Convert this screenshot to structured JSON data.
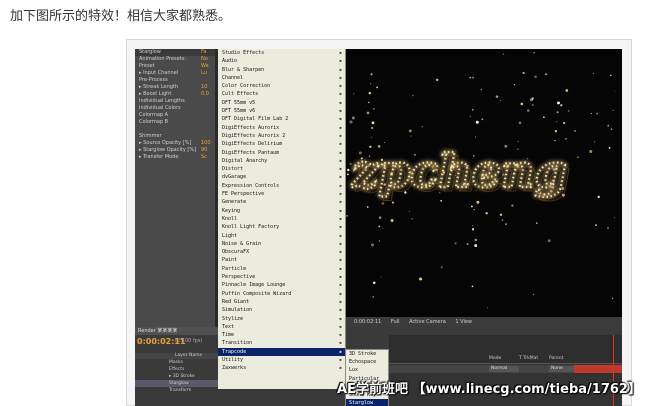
{
  "post": {
    "text": "加下图所示的特效！相信大家都熟悉。"
  },
  "effect_controls": {
    "rows": [
      {
        "label": "Starglow",
        "value": "Fa",
        "head": true
      },
      {
        "label": "Animation Presets:",
        "value": "No"
      },
      {
        "label": "Preset",
        "value": "Wa"
      },
      {
        "label": "▸ Input Channel",
        "value": "Lu"
      },
      {
        "label": "Pre-Process",
        "value": ""
      },
      {
        "label": "▸ Streak Length",
        "value": "10"
      },
      {
        "label": "▸ Boost Light",
        "value": "0.0"
      },
      {
        "label": "Individual Lengths",
        "value": ""
      },
      {
        "label": "Individual Colors",
        "value": ""
      },
      {
        "label": "Colormap A",
        "value": ""
      },
      {
        "label": "Colormap B",
        "value": ""
      },
      {
        "label": "",
        "value": ""
      },
      {
        "label": "Shimmer",
        "value": ""
      },
      {
        "label": "▸ Source Opacity [%]",
        "value": "100"
      },
      {
        "label": "▸ Starglow Opacity [%]",
        "value": "90"
      },
      {
        "label": "▸ Transfer Mode",
        "value": "Sc"
      }
    ]
  },
  "menu": {
    "items": [
      {
        "label": "Studio Effects",
        "has_sub": true
      },
      {
        "label": "Audio",
        "has_sub": true
      },
      {
        "label": "Blur & Sharpen",
        "has_sub": true
      },
      {
        "label": "Channel",
        "has_sub": true
      },
      {
        "label": "Color Correction",
        "has_sub": true
      },
      {
        "label": "Cult Effects",
        "has_sub": true
      },
      {
        "label": "DFT 55mm v5",
        "has_sub": true
      },
      {
        "label": "DFT 55mm v6",
        "has_sub": true
      },
      {
        "label": "DFT Digital Film Lab 2",
        "has_sub": true
      },
      {
        "label": "DigiEffects Aurorix",
        "has_sub": true
      },
      {
        "label": "DigiEffects Aurorix 2",
        "has_sub": true
      },
      {
        "label": "DigiEffects Delirium",
        "has_sub": true
      },
      {
        "label": "DigiEffects Pantaum",
        "has_sub": true
      },
      {
        "label": "Digital Anarchy",
        "has_sub": true
      },
      {
        "label": "Distort",
        "has_sub": true
      },
      {
        "label": "dvGarage",
        "has_sub": true
      },
      {
        "label": "Expression Controls",
        "has_sub": true
      },
      {
        "label": "FE Perspective",
        "has_sub": true
      },
      {
        "label": "Generate",
        "has_sub": true
      },
      {
        "label": "Keying",
        "has_sub": true
      },
      {
        "label": "Knoll",
        "has_sub": true
      },
      {
        "label": "Knoll Light Factory",
        "has_sub": true
      },
      {
        "label": "Light",
        "has_sub": true
      },
      {
        "label": "Noise & Grain",
        "has_sub": true
      },
      {
        "label": "ObscuraFX",
        "has_sub": true
      },
      {
        "label": "Paint",
        "has_sub": true
      },
      {
        "label": "Particle",
        "has_sub": true
      },
      {
        "label": "Perspective",
        "has_sub": true
      },
      {
        "label": "Pinnacle Image Lounge",
        "has_sub": true
      },
      {
        "label": "Puffin Composite Wizard",
        "has_sub": true
      },
      {
        "label": "Red Giant",
        "has_sub": true
      },
      {
        "label": "Simulation",
        "has_sub": true
      },
      {
        "label": "Stylize",
        "has_sub": true
      },
      {
        "label": "Text",
        "has_sub": true
      },
      {
        "label": "Time",
        "has_sub": true
      },
      {
        "label": "Transition",
        "has_sub": true
      },
      {
        "label": "Trapcode",
        "has_sub": true,
        "selected": true
      },
      {
        "label": "Utility",
        "has_sub": true
      },
      {
        "label": "Zaxwerks",
        "has_sub": true
      }
    ]
  },
  "submenu": {
    "items": [
      {
        "label": "3D Stroke"
      },
      {
        "label": "Echospace"
      },
      {
        "label": "Lux"
      },
      {
        "label": "Particular"
      },
      {
        "label": "Shine"
      },
      {
        "label": "Sound Keys"
      },
      {
        "label": "Starglow",
        "selected": true
      }
    ]
  },
  "viewer": {
    "art_text": "zpcheng",
    "zoom": "Full",
    "timecode": "0:00:02:11",
    "camera": "Active Camera",
    "view": "1 View"
  },
  "timeline": {
    "tab": "Render  某某某某",
    "timecode": "0:00:02:11",
    "fps": "(25.00 fps)",
    "header": "Layer Name",
    "rows": [
      {
        "label": "Masks"
      },
      {
        "label": "Effects"
      },
      {
        "label": "▸ 3D Stroke"
      },
      {
        "label": "Starglow",
        "selected": true
      },
      {
        "label": "Transform"
      }
    ],
    "columns": {
      "mode": "Mode",
      "trkmat": "T TrkMat",
      "parent": "Parent"
    },
    "mode_value": "Normal",
    "parent_value": "None"
  },
  "watermark": {
    "text": "AE学前班吧 【www.linecg.com/tieba/1762】"
  },
  "colors": {
    "menu_bg": "#ececde",
    "menu_selected": "#0a246a",
    "accent_orange": "#e7a537",
    "glow": "#ffd27a"
  }
}
